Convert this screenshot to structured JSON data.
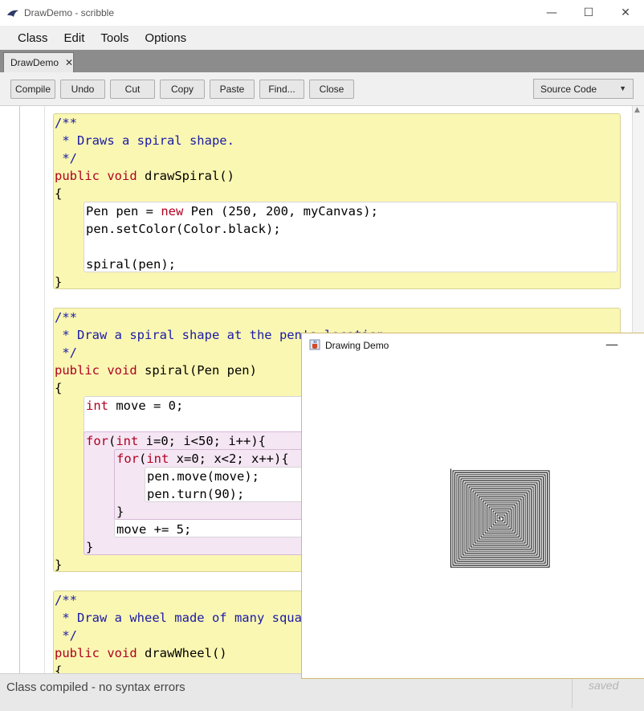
{
  "window": {
    "title": "DrawDemo - scribble",
    "minimize_glyph": "—",
    "maximize_glyph": "☐",
    "close_glyph": "✕"
  },
  "menu": {
    "items": [
      "Class",
      "Edit",
      "Tools",
      "Options"
    ]
  },
  "tab": {
    "label": "DrawDemo",
    "close_glyph": "✕"
  },
  "toolbar": {
    "buttons": [
      "Compile",
      "Undo",
      "Cut",
      "Copy",
      "Paste",
      "Find...",
      "Close"
    ],
    "view_select": "Source Code"
  },
  "code": {
    "method1": {
      "comment": [
        "/**",
        " * Draws a spiral shape.",
        " */"
      ],
      "sig_kw": "public void",
      "sig_name": " drawSpiral()",
      "open": "{",
      "body": [
        [
          "Pen pen = ",
          "new",
          " Pen (250, 200, myCanvas);"
        ],
        "pen.setColor(Color.black);",
        "",
        "spiral(pen);"
      ],
      "close": "}"
    },
    "method2": {
      "comment": [
        "/**",
        " * Draw a spiral shape at the pen's location",
        " */"
      ],
      "sig_kw": "public void",
      "sig_name": " spiral(Pen pen)",
      "open": "{",
      "decl_kw": "int",
      "decl_rest": " move = 0;",
      "for1_kw": "for",
      "for1_a": "(",
      "for1_int": "int",
      "for1_rest": " i=0; i<50; i++){",
      "for2_kw": "for",
      "for2_a": "(",
      "for2_int": "int",
      "for2_rest": " x=0; x<2; x++){",
      "inner1": "pen.move(move);",
      "inner2": "pen.turn(90);",
      "for2_close": "}",
      "inc": "move += 5;",
      "for1_close": "}",
      "close": "}"
    },
    "method3": {
      "comment": [
        "/**",
        " * Draw a wheel made of many squares",
        " */"
      ],
      "sig_kw": "public void",
      "sig_name": " drawWheel()",
      "open": "{"
    }
  },
  "status": {
    "message": "Class compiled - no syntax errors",
    "saved": "saved"
  },
  "drawing_window": {
    "title": "Drawing Demo",
    "minimize_glyph": "—",
    "spiral": {
      "iterations": 50,
      "turns_per_iteration": 2,
      "step_increment": 5,
      "turn_degrees": 90
    }
  },
  "colors": {
    "comment": "#1a1aa6",
    "keyword": "#b00020",
    "method_block": "#faf7b3",
    "loop_block": "#f5e6f4"
  }
}
